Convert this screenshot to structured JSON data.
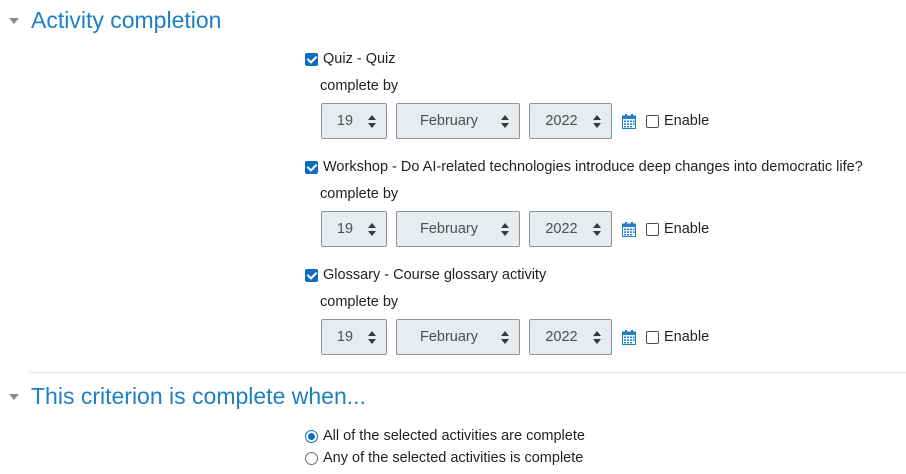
{
  "sections": {
    "activity_title": "Activity completion",
    "criterion_title": "This criterion is complete when..."
  },
  "activities": [
    {
      "label": "Quiz - Quiz",
      "checked": true,
      "complete_by": "complete by",
      "day": "19",
      "month": "February",
      "year": "2022",
      "enable_label": "Enable",
      "enabled": false
    },
    {
      "label": "Workshop - Do AI-related technologies introduce deep changes into democratic life?",
      "checked": true,
      "complete_by": "complete by",
      "day": "19",
      "month": "February",
      "year": "2022",
      "enable_label": "Enable",
      "enabled": false
    },
    {
      "label": "Glossary - Course glossary activity",
      "checked": true,
      "complete_by": "complete by",
      "day": "19",
      "month": "February",
      "year": "2022",
      "enable_label": "Enable",
      "enabled": false
    }
  ],
  "criterion": {
    "options": [
      {
        "label": "All of the selected activities are complete",
        "selected": true
      },
      {
        "label": "Any of the selected activities is complete",
        "selected": false
      }
    ]
  },
  "colors": {
    "accent": "#0f6cbf",
    "heading": "#1f7fc4"
  }
}
